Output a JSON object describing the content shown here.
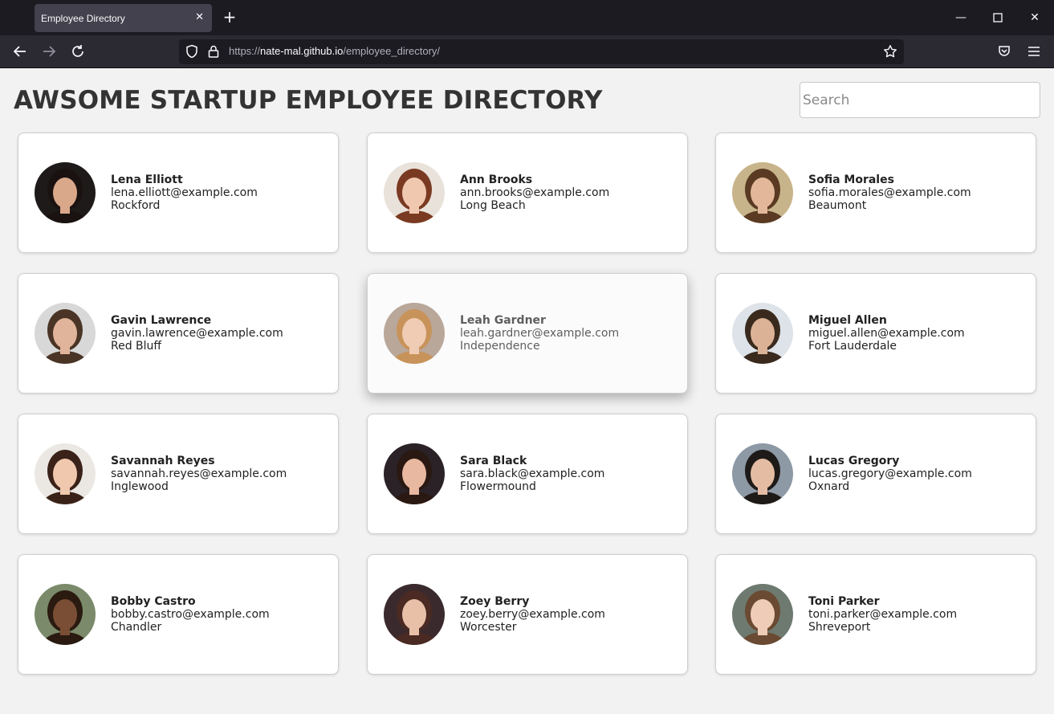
{
  "browser": {
    "tab_title": "Employee Directory",
    "url_prefix": "https://",
    "url_host": "nate-mal.github.io",
    "url_path": "/employee_directory/"
  },
  "header": {
    "title": "AWSOME STARTUP EMPLOYEE DIRECTORY",
    "search_placeholder": "Search"
  },
  "employees": [
    {
      "name": "Lena Elliott",
      "email": "lena.elliott@example.com",
      "city": "Rockford",
      "bg": "#1e1a1a",
      "skin": "#d9a88a",
      "hair": "#1a1210"
    },
    {
      "name": "Ann Brooks",
      "email": "ann.brooks@example.com",
      "city": "Long Beach",
      "bg": "#e9e2da",
      "skin": "#f0c8b0",
      "hair": "#7a3a22"
    },
    {
      "name": "Sofia Morales",
      "email": "sofia.morales@example.com",
      "city": "Beaumont",
      "bg": "#c8b48a",
      "skin": "#e3b89a",
      "hair": "#5a3a22"
    },
    {
      "name": "Gavin Lawrence",
      "email": "gavin.lawrence@example.com",
      "city": "Red Bluff",
      "bg": "#d8d8d8",
      "skin": "#e0b49a",
      "hair": "#4a3426"
    },
    {
      "name": "Leah Gardner",
      "email": "leah.gardner@example.com",
      "city": "Independence",
      "bg": "#b9a79a",
      "skin": "#f0ccb4",
      "hair": "#c8935a"
    },
    {
      "name": "Miguel Allen",
      "email": "miguel.allen@example.com",
      "city": "Fort Lauderdale",
      "bg": "#dde3e8",
      "skin": "#dcb296",
      "hair": "#3a2a1e"
    },
    {
      "name": "Savannah Reyes",
      "email": "savannah.reyes@example.com",
      "city": "Inglewood",
      "bg": "#ebe8e4",
      "skin": "#f0c8ae",
      "hair": "#3a2218"
    },
    {
      "name": "Sara Black",
      "email": "sara.black@example.com",
      "city": "Flowermound",
      "bg": "#2a2226",
      "skin": "#e8b8a0",
      "hair": "#2a1812"
    },
    {
      "name": "Lucas Gregory",
      "email": "lucas.gregory@example.com",
      "city": "Oxnard",
      "bg": "#8e99a6",
      "skin": "#e4bca4",
      "hair": "#1e1a18"
    },
    {
      "name": "Bobby Castro",
      "email": "bobby.castro@example.com",
      "city": "Chandler",
      "bg": "#7a8a6a",
      "skin": "#7a4e34",
      "hair": "#2a1a10"
    },
    {
      "name": "Zoey Berry",
      "email": "zoey.berry@example.com",
      "city": "Worcester",
      "bg": "#3a2a2e",
      "skin": "#e8c0a8",
      "hair": "#4a2a22"
    },
    {
      "name": "Toni Parker",
      "email": "toni.parker@example.com",
      "city": "Shreveport",
      "bg": "#6e7a70",
      "skin": "#efccb8",
      "hair": "#6a4a32"
    }
  ]
}
